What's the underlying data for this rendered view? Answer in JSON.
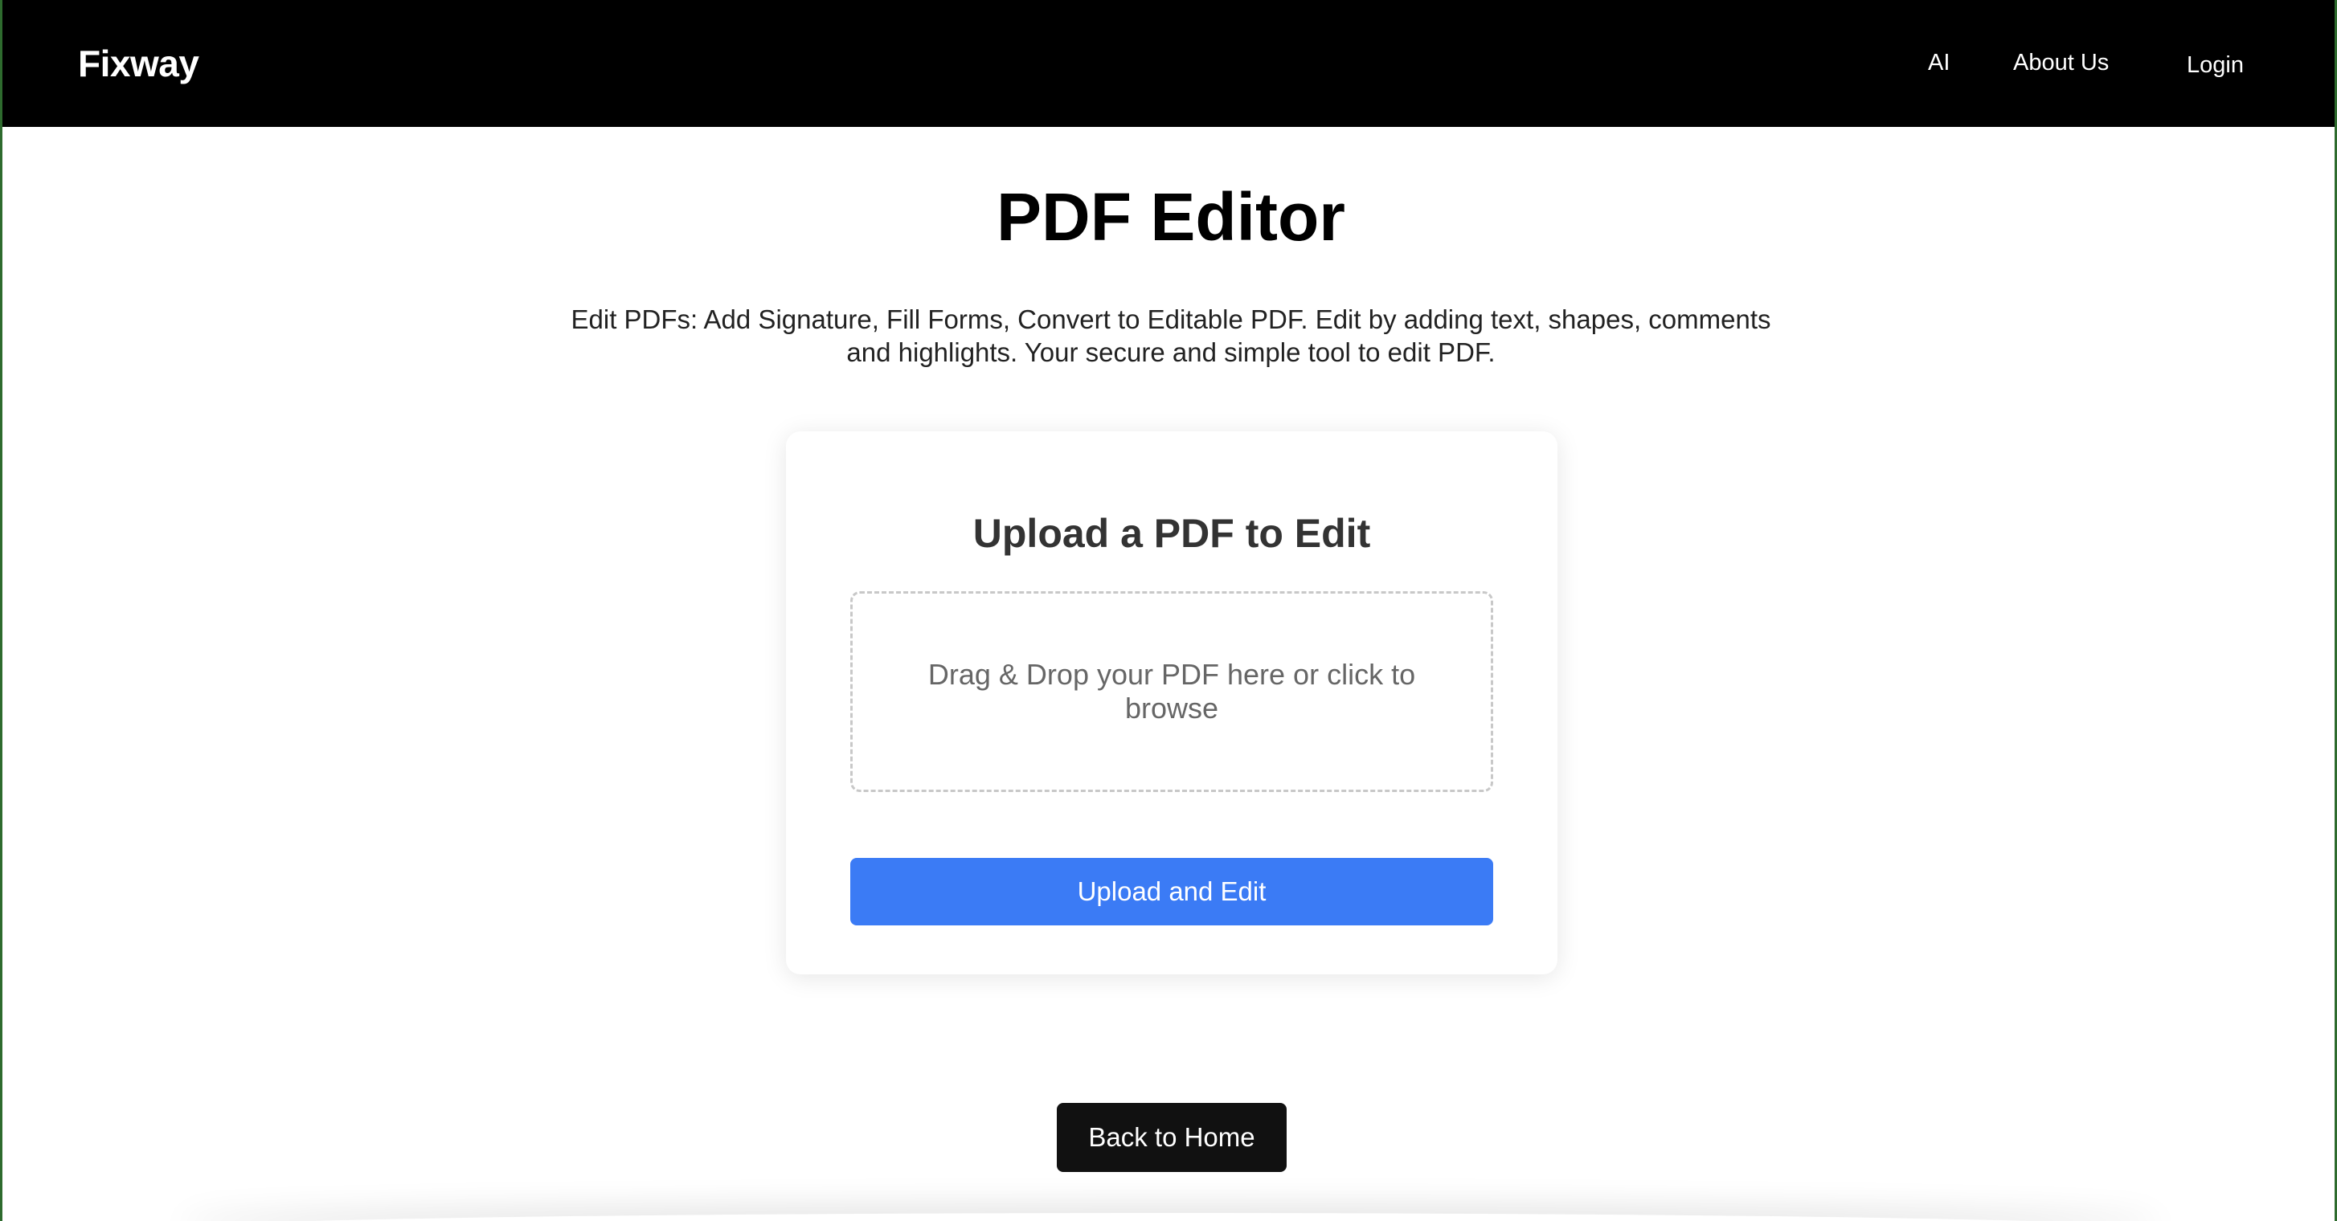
{
  "navbar": {
    "brand": "Fixway",
    "links": [
      "AI",
      "About Us",
      "Login"
    ]
  },
  "main": {
    "title": "PDF Editor",
    "subtitle": "Edit PDFs: Add Signature, Fill Forms, Convert to Editable PDF. Edit by adding text, shapes, comments and highlights. Your secure and simple tool to edit PDF."
  },
  "upload_card": {
    "title": "Upload a PDF to Edit",
    "dropzone_text": "Drag & Drop your PDF here or click to browse",
    "button_label": "Upload and Edit"
  },
  "back_button": "Back to Home",
  "colors": {
    "navbar_bg": "#000000",
    "primary_button": "#3b7bf5",
    "back_button": "#111111"
  }
}
